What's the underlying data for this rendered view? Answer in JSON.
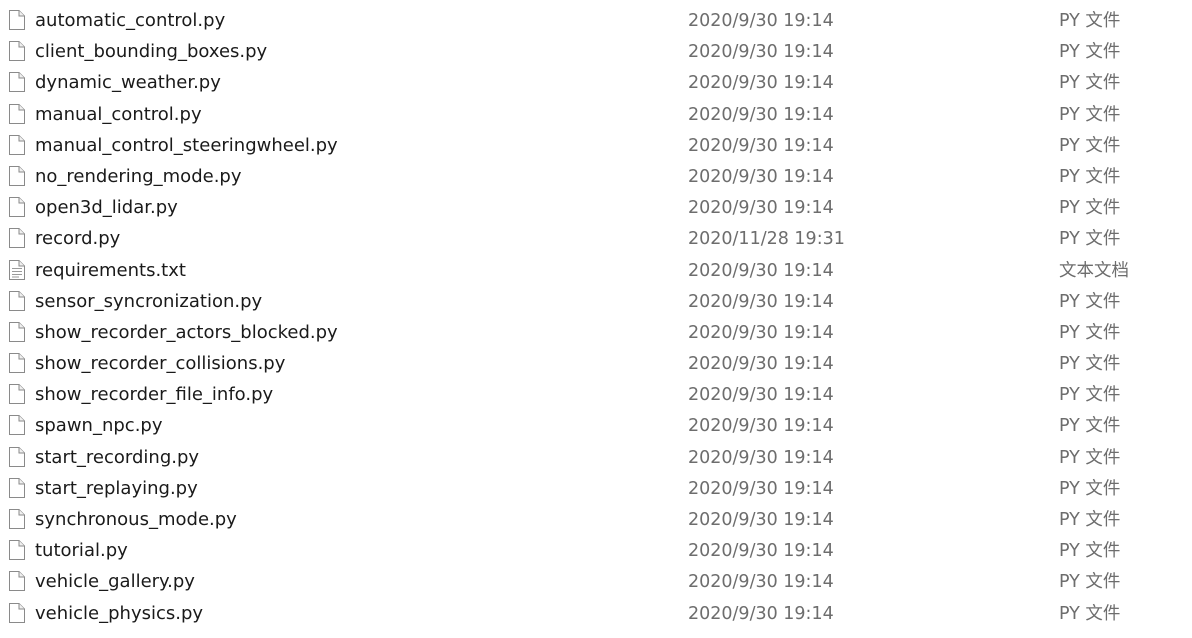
{
  "files": [
    {
      "name": "automatic_control.py",
      "date": "2020/9/30 19:14",
      "type": "PY 文件",
      "icon": "file-icon"
    },
    {
      "name": "client_bounding_boxes.py",
      "date": "2020/9/30 19:14",
      "type": "PY 文件",
      "icon": "file-icon"
    },
    {
      "name": "dynamic_weather.py",
      "date": "2020/9/30 19:14",
      "type": "PY 文件",
      "icon": "file-icon"
    },
    {
      "name": "manual_control.py",
      "date": "2020/9/30 19:14",
      "type": "PY 文件",
      "icon": "file-icon"
    },
    {
      "name": "manual_control_steeringwheel.py",
      "date": "2020/9/30 19:14",
      "type": "PY 文件",
      "icon": "file-icon"
    },
    {
      "name": "no_rendering_mode.py",
      "date": "2020/9/30 19:14",
      "type": "PY 文件",
      "icon": "file-icon"
    },
    {
      "name": "open3d_lidar.py",
      "date": "2020/9/30 19:14",
      "type": "PY 文件",
      "icon": "file-icon"
    },
    {
      "name": "record.py",
      "date": "2020/11/28 19:31",
      "type": "PY 文件",
      "icon": "file-icon"
    },
    {
      "name": "requirements.txt",
      "date": "2020/9/30 19:14",
      "type": "文本文档",
      "icon": "text-document-icon"
    },
    {
      "name": "sensor_syncronization.py",
      "date": "2020/9/30 19:14",
      "type": "PY 文件",
      "icon": "file-icon"
    },
    {
      "name": "show_recorder_actors_blocked.py",
      "date": "2020/9/30 19:14",
      "type": "PY 文件",
      "icon": "file-icon"
    },
    {
      "name": "show_recorder_collisions.py",
      "date": "2020/9/30 19:14",
      "type": "PY 文件",
      "icon": "file-icon"
    },
    {
      "name": "show_recorder_file_info.py",
      "date": "2020/9/30 19:14",
      "type": "PY 文件",
      "icon": "file-icon"
    },
    {
      "name": "spawn_npc.py",
      "date": "2020/9/30 19:14",
      "type": "PY 文件",
      "icon": "file-icon"
    },
    {
      "name": "start_recording.py",
      "date": "2020/9/30 19:14",
      "type": "PY 文件",
      "icon": "file-icon"
    },
    {
      "name": "start_replaying.py",
      "date": "2020/9/30 19:14",
      "type": "PY 文件",
      "icon": "file-icon"
    },
    {
      "name": "synchronous_mode.py",
      "date": "2020/9/30 19:14",
      "type": "PY 文件",
      "icon": "file-icon"
    },
    {
      "name": "tutorial.py",
      "date": "2020/9/30 19:14",
      "type": "PY 文件",
      "icon": "file-icon"
    },
    {
      "name": "vehicle_gallery.py",
      "date": "2020/9/30 19:14",
      "type": "PY 文件",
      "icon": "file-icon"
    },
    {
      "name": "vehicle_physics.py",
      "date": "2020/9/30 19:14",
      "type": "PY 文件",
      "icon": "file-icon"
    }
  ],
  "colors": {
    "name_text": "#1a1a1a",
    "meta_text": "#6d6d6d",
    "icon_outline": "#8a8a8a",
    "background": "#ffffff"
  }
}
